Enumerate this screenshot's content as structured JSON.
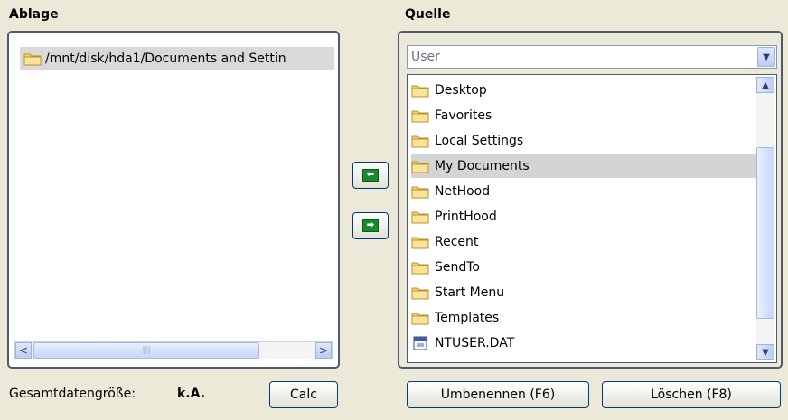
{
  "left": {
    "label": "Ablage",
    "items": [
      "/mnt/disk/hda1/Documents and Settin"
    ],
    "scroll_left": "<",
    "scroll_right": ">",
    "scroll_grip": "|||"
  },
  "right": {
    "label": "Quelle",
    "dropdown_value": "User",
    "dropdown_arrow": "▼",
    "scroll_up": "▲",
    "scroll_down": "▼",
    "items": [
      {
        "label": "Desktop",
        "icon": "folder-icon",
        "selected": false
      },
      {
        "label": "Favorites",
        "icon": "folder-icon",
        "selected": false
      },
      {
        "label": "Local Settings",
        "icon": "folder-icon",
        "selected": false
      },
      {
        "label": "My Documents",
        "icon": "folder-icon",
        "selected": true
      },
      {
        "label": "NetHood",
        "icon": "folder-icon",
        "selected": false
      },
      {
        "label": "PrintHood",
        "icon": "folder-icon",
        "selected": false
      },
      {
        "label": "Recent",
        "icon": "folder-icon",
        "selected": false
      },
      {
        "label": "SendTo",
        "icon": "folder-icon",
        "selected": false
      },
      {
        "label": "Start Menu",
        "icon": "folder-icon",
        "selected": false
      },
      {
        "label": "Templates",
        "icon": "folder-icon",
        "selected": false
      },
      {
        "label": "NTUSER.DAT",
        "icon": "file-icon",
        "selected": false
      }
    ]
  },
  "middle": {
    "move_left_glyph": "⬅",
    "move_right_glyph": "➡"
  },
  "footer": {
    "total_size_label": "Gesamtdatengröße:",
    "total_size_value": "k.A.",
    "calc_button": "Calc",
    "rename_button": "Umbenennen (F6)",
    "delete_button": "Löschen (F8)"
  },
  "colors": {
    "background": "#ece9d8",
    "selection": "#d4d4d4",
    "arrow_green": "#178a2e",
    "folder_yellow": "#f5d66a"
  }
}
